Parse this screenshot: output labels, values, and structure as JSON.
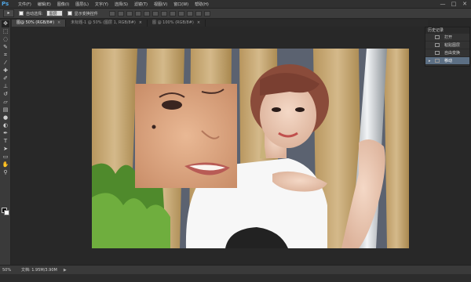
{
  "app": {
    "logo": "Ps"
  },
  "menu": [
    "文件(F)",
    "编辑(E)",
    "图像(I)",
    "图层(L)",
    "文字(Y)",
    "选择(S)",
    "滤镜(T)",
    "视图(V)",
    "窗口(W)",
    "帮助(H)"
  ],
  "window_controls": {
    "minimize": "—",
    "maximize": "□",
    "close": "✕"
  },
  "options": {
    "tool_glyph": "▸",
    "auto_select_label": "自动选择:",
    "auto_select_value": "图层",
    "show_transform_label": "显示变换控件"
  },
  "tabs": [
    {
      "label": "图@ 50% (RGB/8#)",
      "close": "×",
      "active": true
    },
    {
      "label": "未标题-1 @ 50% (图层 1, RGB/8#)",
      "close": "×",
      "active": false
    },
    {
      "label": "图 @ 100% (RGB/8#)",
      "close": "×",
      "active": false
    }
  ],
  "history": {
    "title": "历史记录",
    "items": [
      {
        "label": "打开",
        "selected": false
      },
      {
        "label": "粘贴图层",
        "selected": false
      },
      {
        "label": "自由变换",
        "selected": false
      },
      {
        "label": "移动",
        "selected": true
      }
    ]
  },
  "status": {
    "zoom": "50%",
    "doc_info": "文档: 1.95M/3.90M",
    "arrow": "▶"
  },
  "tools": [
    "move",
    "marquee",
    "lasso",
    "quick-select",
    "crop",
    "eyedropper",
    "healing",
    "brush",
    "stamp",
    "history-brush",
    "eraser",
    "gradient",
    "blur",
    "dodge",
    "pen",
    "type",
    "path-select",
    "shape",
    "hand",
    "zoom"
  ],
  "colors": {
    "accent": "#5c6f84",
    "background": "#282828",
    "panel": "#3a3a3a"
  }
}
